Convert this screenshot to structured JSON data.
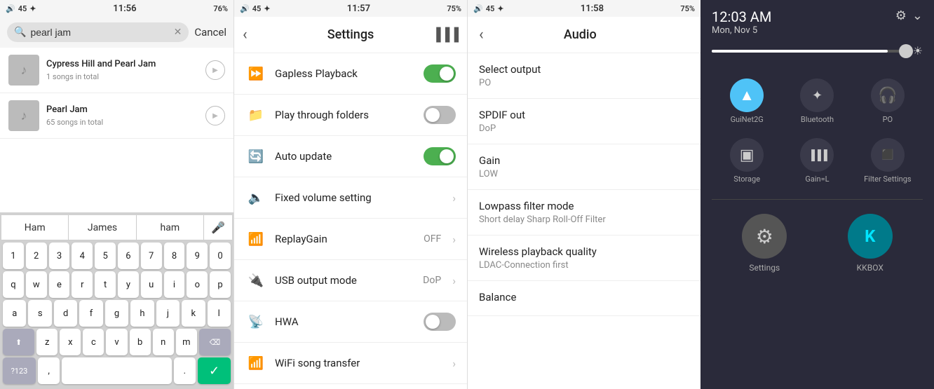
{
  "panel1": {
    "status": {
      "left": "45",
      "bluetooth": "BT",
      "time": "11:56",
      "battery": "76%"
    },
    "search": {
      "placeholder": "pearl jam",
      "cancel_label": "Cancel"
    },
    "songs": [
      {
        "title": "Cypress Hill and Pearl Jam",
        "subtitle": "1 songs in total"
      },
      {
        "title": "Pearl Jam",
        "subtitle": "65 songs in total"
      }
    ],
    "keyboard": {
      "suggestions": [
        "Ham",
        "James",
        "ham"
      ],
      "rows": [
        [
          "1",
          "2",
          "3",
          "4",
          "5",
          "6",
          "7",
          "8",
          "9",
          "0"
        ],
        [
          "q",
          "w",
          "e",
          "r",
          "t",
          "y",
          "u",
          "i",
          "o",
          "p"
        ],
        [
          "a",
          "s",
          "d",
          "f",
          "g",
          "h",
          "j",
          "k",
          "l"
        ],
        [
          "z",
          "x",
          "c",
          "v",
          "b",
          "n",
          "m"
        ],
        [
          "?123",
          ",",
          " ",
          ".",
          "✓"
        ]
      ]
    }
  },
  "panel2": {
    "status": {
      "left": "45",
      "time": "11:57",
      "battery": "75%"
    },
    "title": "Settings",
    "items": [
      {
        "label": "Gapless Playback",
        "type": "toggle",
        "value": "on"
      },
      {
        "label": "Play through folders",
        "type": "toggle",
        "value": "off"
      },
      {
        "label": "Auto update",
        "type": "toggle",
        "value": "on"
      },
      {
        "label": "Fixed volume setting",
        "type": "chevron",
        "value": ""
      },
      {
        "label": "ReplayGain",
        "type": "value",
        "value": "OFF"
      },
      {
        "label": "USB output mode",
        "type": "value",
        "value": "DoP"
      },
      {
        "label": "HWA",
        "type": "toggle",
        "value": "off"
      },
      {
        "label": "WiFi song transfer",
        "type": "chevron",
        "value": ""
      }
    ]
  },
  "panel3": {
    "status": {
      "left": "45",
      "time": "11:58",
      "battery": "75%"
    },
    "title": "Audio",
    "items": [
      {
        "title": "Select output",
        "sub": "PO"
      },
      {
        "title": "SPDIF out",
        "sub": "DoP"
      },
      {
        "title": "Gain",
        "sub": "LOW"
      },
      {
        "title": "Lowpass filter mode",
        "sub": "Short delay Sharp Roll-Off Filter"
      },
      {
        "title": "Wireless playback quality",
        "sub": "LDAC-Connection first"
      },
      {
        "title": "Balance",
        "sub": ""
      }
    ]
  },
  "panel4": {
    "time": "12:03 AM",
    "date": "Mon, Nov 5",
    "tiles": [
      {
        "label": "GuiNet2G",
        "active": true,
        "icon": "▲"
      },
      {
        "label": "Bluetooth",
        "active": false,
        "icon": "✦"
      },
      {
        "label": "PO",
        "active": false,
        "icon": "🎧"
      },
      {
        "label": "Storage",
        "active": false,
        "icon": "▣"
      },
      {
        "label": "Gain=L",
        "active": false,
        "icon": "▌▌▌"
      },
      {
        "label": "Filter Settings",
        "active": false,
        "icon": "⬛"
      }
    ],
    "apps": [
      {
        "label": "Settings",
        "icon": "⚙",
        "type": "grey"
      },
      {
        "label": "KKBOX",
        "icon": "K",
        "type": "teal"
      }
    ]
  }
}
